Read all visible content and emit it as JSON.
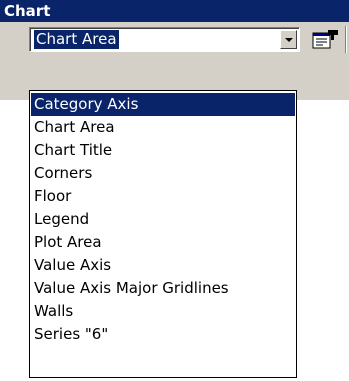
{
  "toolbar": {
    "title": "Chart",
    "selected_object": "Chart Area",
    "dropdown_arrow_icon": "chevron-down-icon",
    "format_button_icon": "format-properties-icon"
  },
  "dropdown": {
    "highlighted": "Category Axis",
    "items": [
      "Category Axis",
      "Chart Area",
      "Chart Title",
      "Corners",
      "Floor",
      "Legend",
      "Plot Area",
      "Value Axis",
      "Value Axis Major Gridlines",
      "Walls",
      "Series \"6\""
    ]
  },
  "colors": {
    "titlebar": "#0a246a",
    "highlight": "#0a246a",
    "face": "#d4d0c8"
  }
}
